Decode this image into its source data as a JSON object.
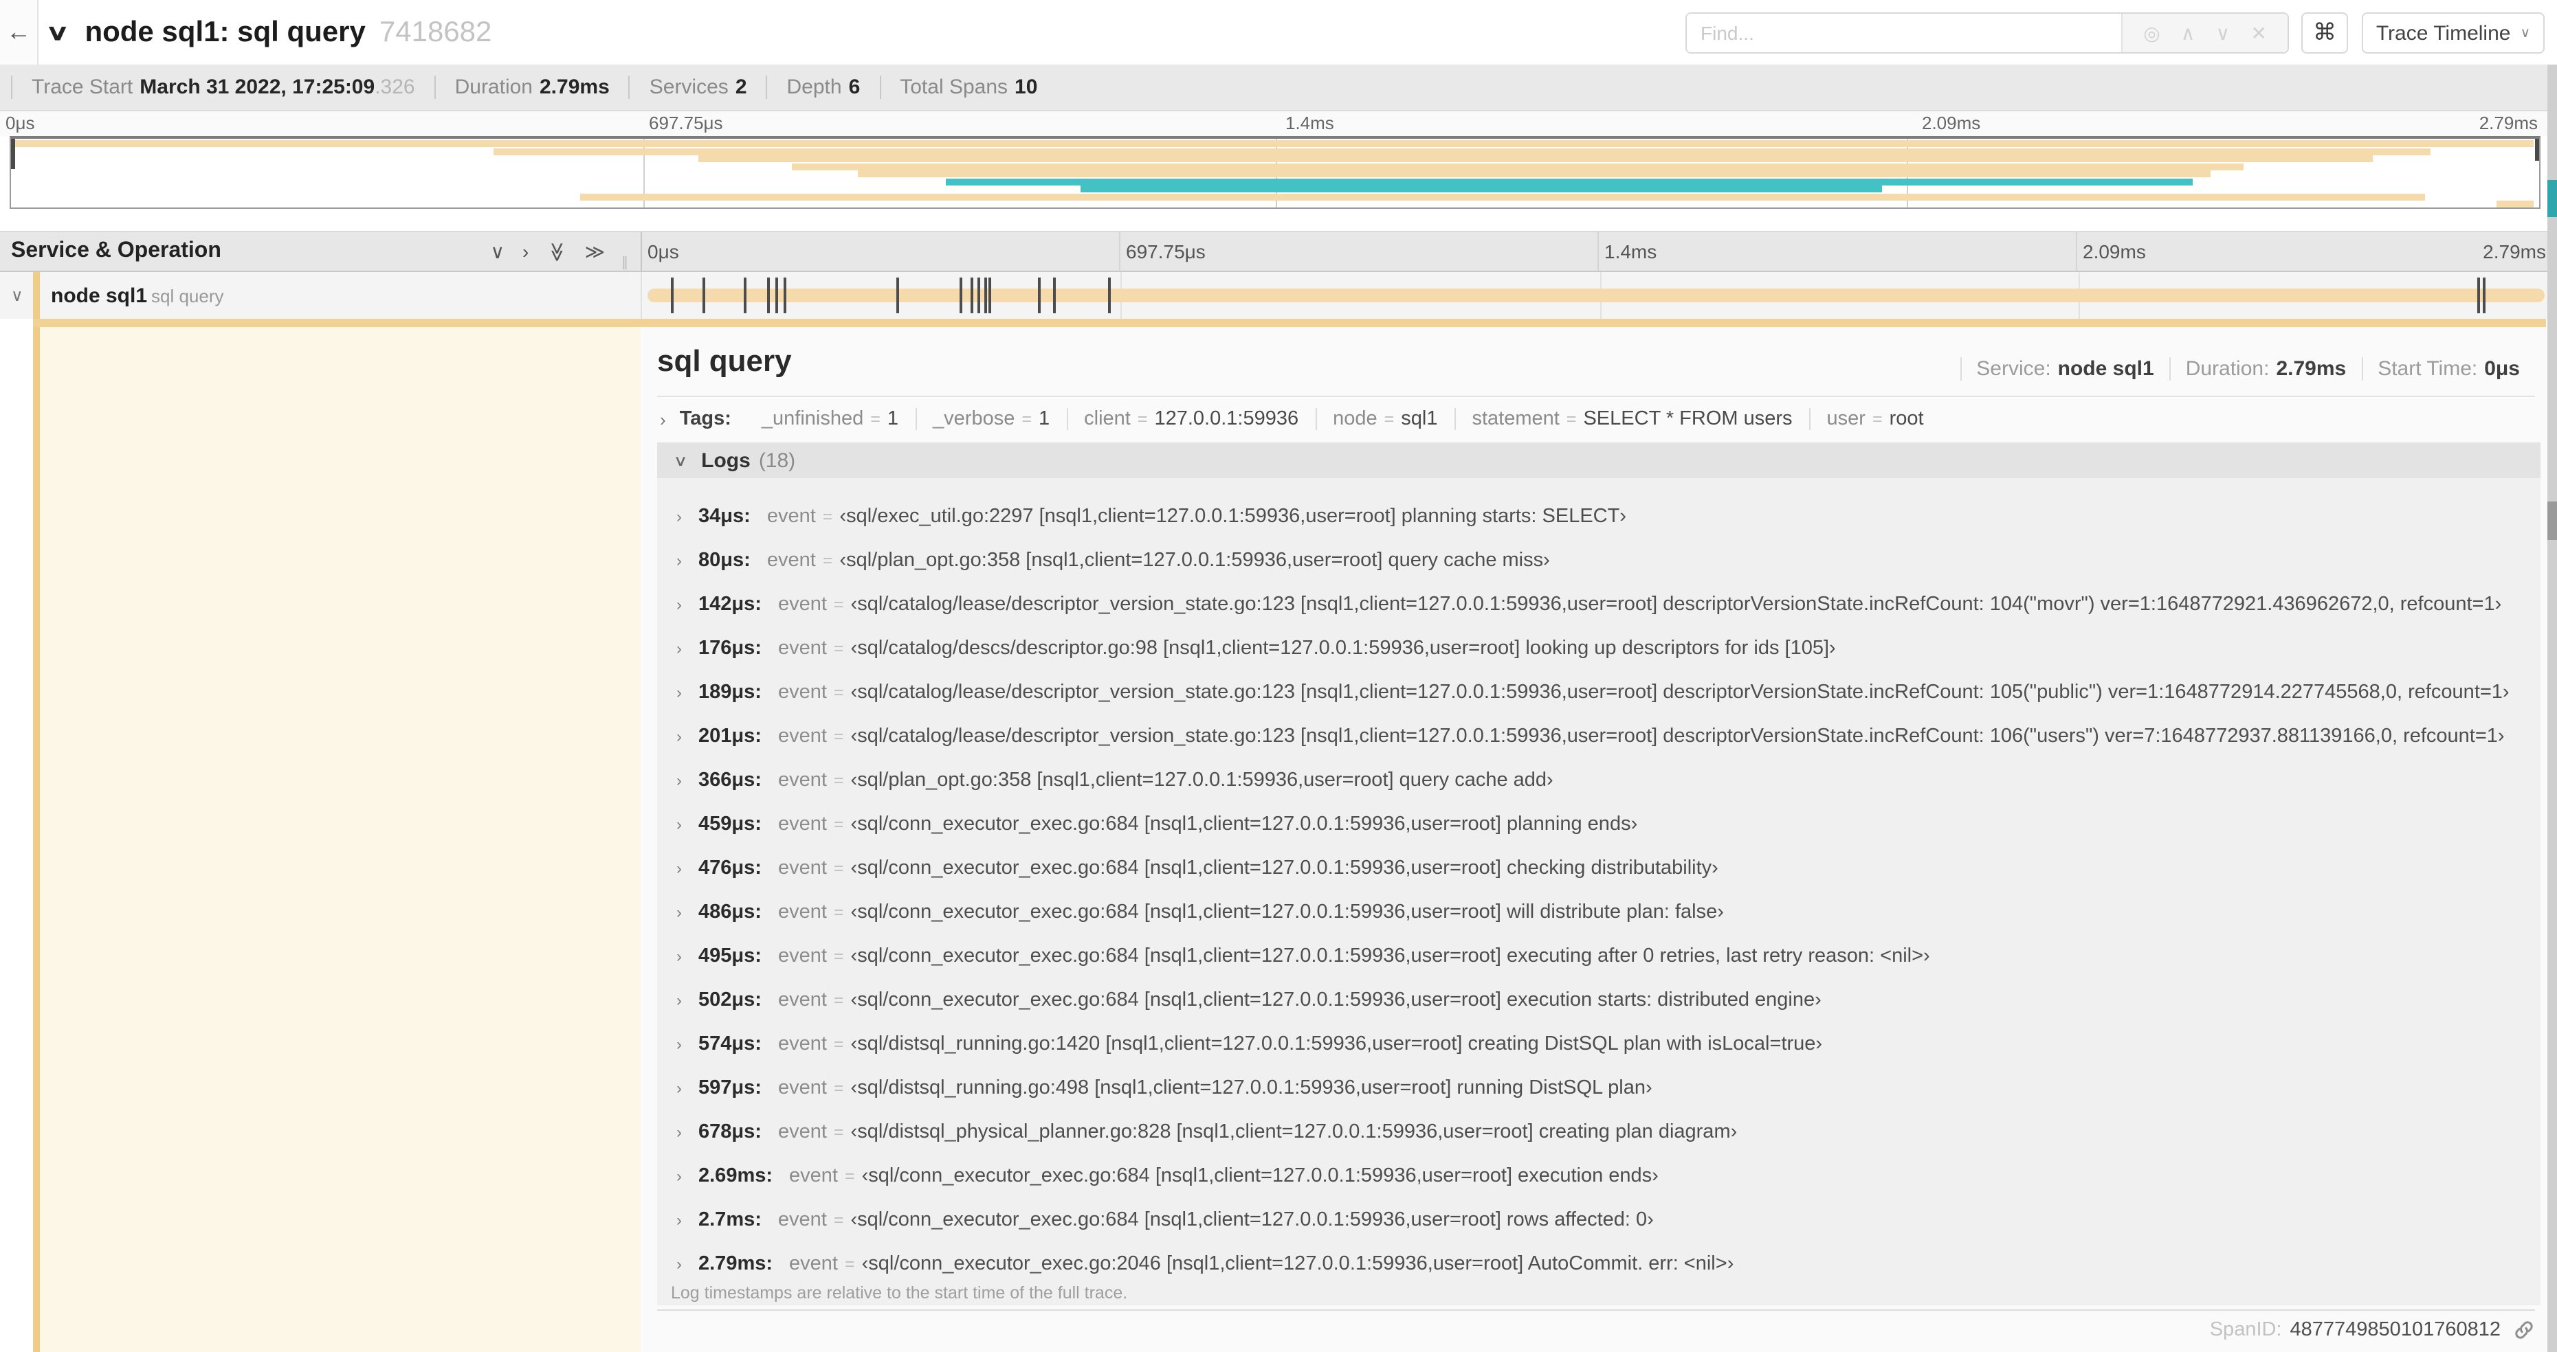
{
  "icons": {
    "back": "←",
    "chevron_down": "∨",
    "chevron_right": "›",
    "double_chevron_right": "≫",
    "command": "⌘",
    "target": "◎",
    "find_prev": "∧",
    "find_next": "∨",
    "find_clear": "✕",
    "grip": "∥",
    "eq": "="
  },
  "header": {
    "title": "node sql1: sql query",
    "trace_id": "7418682",
    "find_placeholder": "Find...",
    "view_selector": "Trace Timeline"
  },
  "summary": {
    "items": [
      {
        "label": "Trace Start",
        "value": "March 31 2022, 17:25:09",
        "suffix": ".326"
      },
      {
        "label": "Duration",
        "value": "2.79ms"
      },
      {
        "label": "Services",
        "value": "2"
      },
      {
        "label": "Depth",
        "value": "6"
      },
      {
        "label": "Total Spans",
        "value": "10"
      }
    ]
  },
  "minimap": {
    "labels": [
      "0μs",
      "697.75μs",
      "1.4ms",
      "2.09ms",
      "2.79ms"
    ],
    "colors": {
      "tan": "#f5dbab",
      "teal": "#43c1c5"
    },
    "spans": [
      {
        "row": 0,
        "x1": 0,
        "x2": 99.8,
        "color": "tan"
      },
      {
        "row": 1,
        "x1": 19.1,
        "x2": 95.7,
        "color": "tan"
      },
      {
        "row": 2,
        "x1": 27.2,
        "x2": 93.4,
        "color": "tan"
      },
      {
        "row": 3,
        "x1": 30.9,
        "x2": 88.3,
        "color": "tan"
      },
      {
        "row": 4,
        "x1": 33.5,
        "x2": 87.0,
        "color": "tan"
      },
      {
        "row": 5,
        "x1": 37.0,
        "x2": 86.3,
        "color": "teal"
      },
      {
        "row": 6,
        "x1": 42.3,
        "x2": 74.0,
        "color": "teal"
      },
      {
        "row": 7,
        "x1": 22.5,
        "x2": 95.5,
        "color": "tan"
      },
      {
        "row": 8,
        "x1": 98.3,
        "x2": 99.8,
        "color": "tan"
      }
    ]
  },
  "grid": {
    "left_header": "Service & Operation",
    "ruler_labels": [
      "0μs",
      "697.75μs",
      "1.4ms",
      "2.09ms",
      "2.79ms"
    ]
  },
  "span_row": {
    "service": "node sql1",
    "operation": "sql query",
    "bar_color": "#f5dbab",
    "stripe_color": "#f0cd86",
    "strip_color": "#f2d194",
    "cream_color": "#fdf7e7",
    "tick_pcts": [
      1.22,
      2.87,
      5.09,
      6.31,
      6.77,
      7.2,
      13.12,
      16.45,
      17.06,
      17.42,
      17.74,
      17.99,
      20.57,
      21.4,
      24.3,
      96.42,
      96.77
    ]
  },
  "detail": {
    "title": "sql query",
    "meta": [
      {
        "label": "Service:",
        "value": "node sql1"
      },
      {
        "label": "Duration:",
        "value": "2.79ms"
      },
      {
        "label": "Start Time:",
        "value": "0μs"
      }
    ],
    "tags_label": "Tags:",
    "tags": [
      {
        "key": "_unfinished",
        "value": "1"
      },
      {
        "key": "_verbose",
        "value": "1"
      },
      {
        "key": "client",
        "value": "127.0.0.1:59936"
      },
      {
        "key": "node",
        "value": "sql1"
      },
      {
        "key": "statement",
        "value": "SELECT * FROM users"
      },
      {
        "key": "user",
        "value": "root"
      }
    ],
    "logs_label": "Logs",
    "logs_count": "(18)",
    "logs": [
      {
        "ts": "34μs:",
        "key": "event",
        "msg": "‹sql/exec_util.go:2297 [nsql1,client=127.0.0.1:59936,user=root] planning starts: SELECT›"
      },
      {
        "ts": "80μs:",
        "key": "event",
        "msg": "‹sql/plan_opt.go:358 [nsql1,client=127.0.0.1:59936,user=root] query cache miss›"
      },
      {
        "ts": "142μs:",
        "key": "event",
        "msg": "‹sql/catalog/lease/descriptor_version_state.go:123 [nsql1,client=127.0.0.1:59936,user=root] descriptorVersionState.incRefCount: 104(\"movr\") ver=1:1648772921.436962672,0, refcount=1›"
      },
      {
        "ts": "176μs:",
        "key": "event",
        "msg": "‹sql/catalog/descs/descriptor.go:98 [nsql1,client=127.0.0.1:59936,user=root] looking up descriptors for ids [105]›"
      },
      {
        "ts": "189μs:",
        "key": "event",
        "msg": "‹sql/catalog/lease/descriptor_version_state.go:123 [nsql1,client=127.0.0.1:59936,user=root] descriptorVersionState.incRefCount: 105(\"public\") ver=1:1648772914.227745568,0, refcount=1›"
      },
      {
        "ts": "201μs:",
        "key": "event",
        "msg": "‹sql/catalog/lease/descriptor_version_state.go:123 [nsql1,client=127.0.0.1:59936,user=root] descriptorVersionState.incRefCount: 106(\"users\") ver=7:1648772937.881139166,0, refcount=1›"
      },
      {
        "ts": "366μs:",
        "key": "event",
        "msg": "‹sql/plan_opt.go:358 [nsql1,client=127.0.0.1:59936,user=root] query cache add›"
      },
      {
        "ts": "459μs:",
        "key": "event",
        "msg": "‹sql/conn_executor_exec.go:684 [nsql1,client=127.0.0.1:59936,user=root] planning ends›"
      },
      {
        "ts": "476μs:",
        "key": "event",
        "msg": "‹sql/conn_executor_exec.go:684 [nsql1,client=127.0.0.1:59936,user=root] checking distributability›"
      },
      {
        "ts": "486μs:",
        "key": "event",
        "msg": "‹sql/conn_executor_exec.go:684 [nsql1,client=127.0.0.1:59936,user=root] will distribute plan: false›"
      },
      {
        "ts": "495μs:",
        "key": "event",
        "msg": "‹sql/conn_executor_exec.go:684 [nsql1,client=127.0.0.1:59936,user=root] executing after 0 retries, last retry reason: <nil>›"
      },
      {
        "ts": "502μs:",
        "key": "event",
        "msg": "‹sql/conn_executor_exec.go:684 [nsql1,client=127.0.0.1:59936,user=root] execution starts: distributed engine›"
      },
      {
        "ts": "574μs:",
        "key": "event",
        "msg": "‹sql/distsql_running.go:1420 [nsql1,client=127.0.0.1:59936,user=root] creating DistSQL plan with isLocal=true›"
      },
      {
        "ts": "597μs:",
        "key": "event",
        "msg": "‹sql/distsql_running.go:498 [nsql1,client=127.0.0.1:59936,user=root] running DistSQL plan›"
      },
      {
        "ts": "678μs:",
        "key": "event",
        "msg": "‹sql/distsql_physical_planner.go:828 [nsql1,client=127.0.0.1:59936,user=root] creating plan diagram›"
      },
      {
        "ts": "2.69ms:",
        "key": "event",
        "msg": "‹sql/conn_executor_exec.go:684 [nsql1,client=127.0.0.1:59936,user=root] execution ends›"
      },
      {
        "ts": "2.7ms:",
        "key": "event",
        "msg": "‹sql/conn_executor_exec.go:684 [nsql1,client=127.0.0.1:59936,user=root] rows affected: 0›"
      },
      {
        "ts": "2.79ms:",
        "key": "event",
        "msg": "‹sql/conn_executor_exec.go:2046 [nsql1,client=127.0.0.1:59936,user=root] AutoCommit. err: <nil>›"
      }
    ],
    "footer_note": "Log timestamps are relative to the start time of the full trace.",
    "span_id_label": "SpanID:",
    "span_id": "4877749850101760812"
  }
}
